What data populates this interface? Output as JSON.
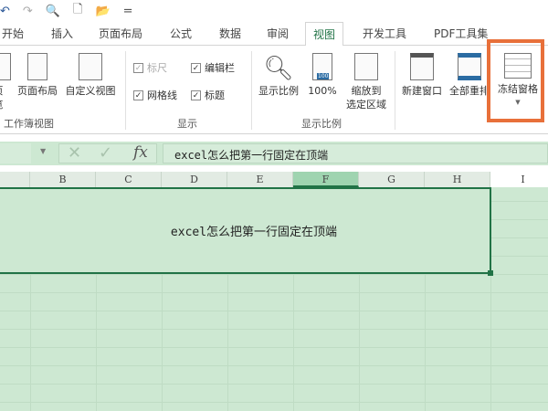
{
  "quick_access": {
    "undo": "↶",
    "redo": "↷",
    "more": "="
  },
  "tabs": [
    "开始",
    "插入",
    "页面布局",
    "公式",
    "数据",
    "审阅",
    "视图",
    "开发工具",
    "PDF工具集"
  ],
  "active_tab": "视图",
  "ribbon": {
    "workbook_views": {
      "label": "工作簿视图",
      "buttons": [
        "页\n览",
        "页面布局",
        "自定义视图"
      ]
    },
    "show": {
      "label": "显示",
      "checkboxes": [
        {
          "label": "标尺",
          "checked": true,
          "disabled": true
        },
        {
          "label": "编辑栏",
          "checked": true
        },
        {
          "label": "网格线",
          "checked": true
        },
        {
          "label": "标题",
          "checked": true
        }
      ]
    },
    "zoom": {
      "label": "显示比例",
      "buttons": [
        "显示比例",
        "100%",
        "缩放到\n选定区域"
      ],
      "badge": "100"
    },
    "window": {
      "buttons": [
        "新建窗口",
        "全部重排",
        "冻结窗格"
      ]
    }
  },
  "formula_bar": {
    "value": "excel怎么把第一行固定在顶端",
    "cancel": "✕",
    "enter": "✓",
    "fx": "fx"
  },
  "columns": [
    "B",
    "C",
    "D",
    "E",
    "F",
    "G",
    "H",
    "I"
  ],
  "selected_column": "F",
  "cell_text": "excel怎么把第一行固定在顶端",
  "accent": "#217346",
  "highlight": "#e8703a"
}
